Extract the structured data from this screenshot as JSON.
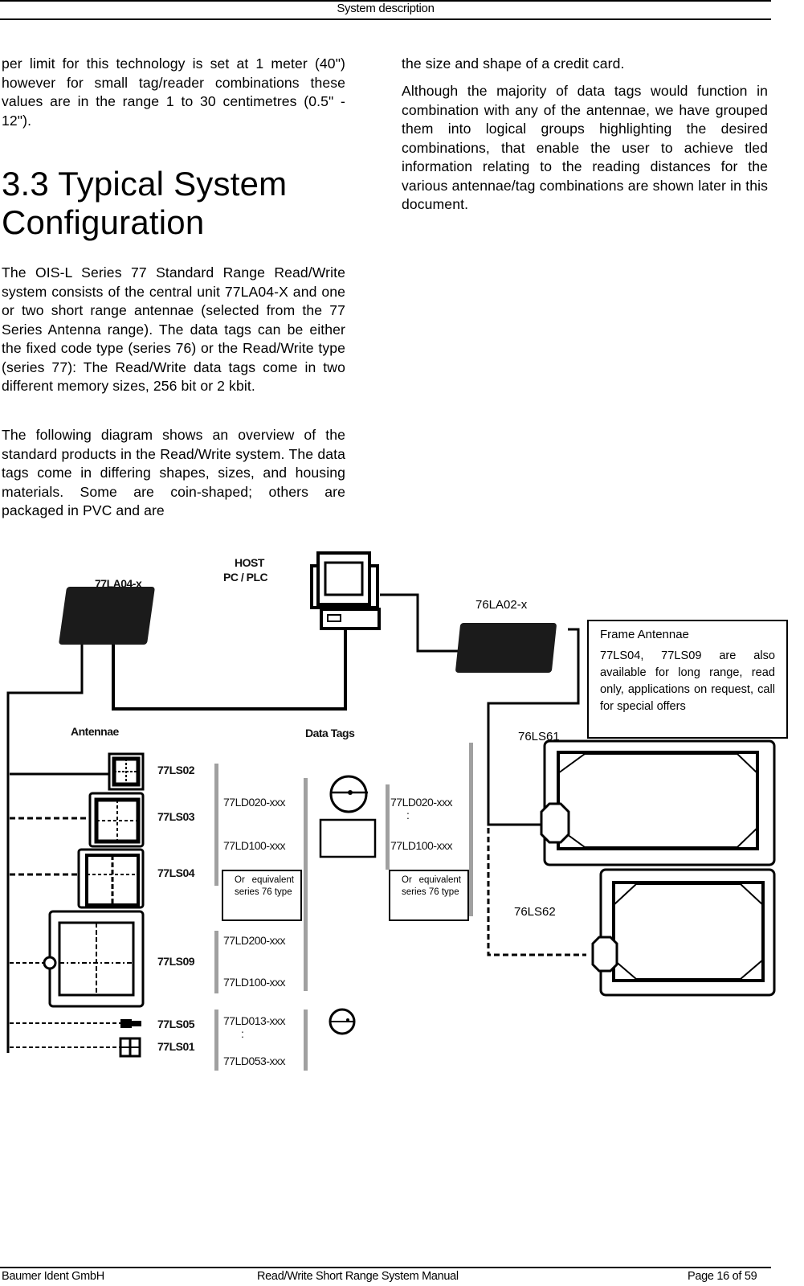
{
  "header": {
    "title": "System description"
  },
  "left_column": {
    "intro_paragraph": "per limit for this technology is set at 1 meter (40\") however for small tag/reader combinations these values are in the range 1 to 30 centimetres (0.5\" - 12\").",
    "section_heading": "3.3 Typical System Configuration",
    "paragraphs": [
      "The OIS-L Series 77 Standard Range Read/Write system consists of the central unit 77LA04-X and one or two short range antennae (selected from the 77 Series Antenna range). The data tags can be either the fixed code type (series 76) or the Read/Write type (series 77): The Read/Write data tags come in two different memory sizes, 256 bit or 2 kbit.",
      "The following diagram shows an overview of the standard products in the Read/Write system. The data tags come in differing shapes, sizes, and housing materials. Some are coin-shaped; others are packaged in PVC and are"
    ]
  },
  "right_column": {
    "paragraphs": [
      "the size and shape of a credit card.",
      "Although the majority of data tags would function in combination with any of the antennae, we have grouped them into logical groups highlighting the desired combinations, that enable the user to achieve tled information relating to the reading distances for the various antennae/tag combinations are shown later in this document."
    ]
  },
  "diagram": {
    "central_unit_label": "77LA04-x",
    "host_label_line1": "HOST",
    "host_label_line2": "PC / PLC",
    "fixed_code_unit_label": "76LA02-x",
    "antennae_heading": "Antennae",
    "data_tags_heading": "Data Tags",
    "antennas": [
      {
        "label": "77LS02",
        "line": "solid"
      },
      {
        "label": "77LS03",
        "line": "dashed"
      },
      {
        "label": "77LS04",
        "line": "dashed"
      },
      {
        "label": "77LS09",
        "line": "dashed"
      },
      {
        "label": "77LS05",
        "line": "dashed"
      },
      {
        "label": "77LS01",
        "line": "dashed"
      }
    ],
    "tag_groups": [
      {
        "top": "77LD020-xxx",
        "bottom": "77LD100-xxx",
        "note": "Or equivalent series 76 type"
      },
      {
        "top": "77LD200-xxx",
        "bottom": "77LD100-xxx"
      },
      {
        "top": "77LD013-xxx",
        "bottom": "77LD053-xxx"
      }
    ],
    "tag_group_right": {
      "top": "77LD020-xxx",
      "bottom": "77LD100-xxx",
      "note": "Or equivalent series 76 type"
    },
    "frame_antennas": [
      {
        "label": "76LS61"
      },
      {
        "label": "76LS62"
      }
    ],
    "frame_note": {
      "title": "Frame Antennae",
      "body": "77LS04, 77LS09 are also available for long range, read only, applications on request, call for special offers"
    }
  },
  "footer": {
    "company": "Baumer Ident GmbH",
    "document_title": "Read/Write Short Range System Manual",
    "page_label": "Page 16 of 59"
  }
}
